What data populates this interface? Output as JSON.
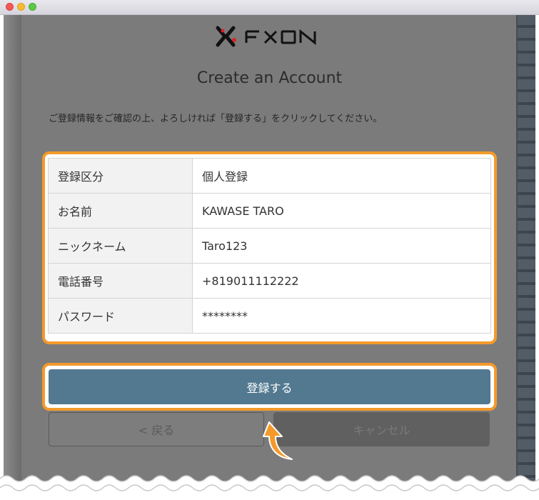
{
  "logo": {
    "text": "FXON"
  },
  "page": {
    "heading": "Create an Account",
    "instruction": "ご登録情報をご確認の上、よろしければ「登録する」をクリックしてください。"
  },
  "details": [
    {
      "label": "登録区分",
      "value": "個人登録"
    },
    {
      "label": "お名前",
      "value": "KAWASE TARO"
    },
    {
      "label": "ニックネーム",
      "value": "Taro123"
    },
    {
      "label": "電話番号",
      "value": "+819011112222"
    },
    {
      "label": "パスワード",
      "value": "********"
    }
  ],
  "buttons": {
    "submit": "登録する",
    "back": "< 戻る",
    "cancel": "キャンセル"
  },
  "colors": {
    "highlight": "#f39a2b",
    "submit": "#527990",
    "logo_red": "#d8232a"
  }
}
